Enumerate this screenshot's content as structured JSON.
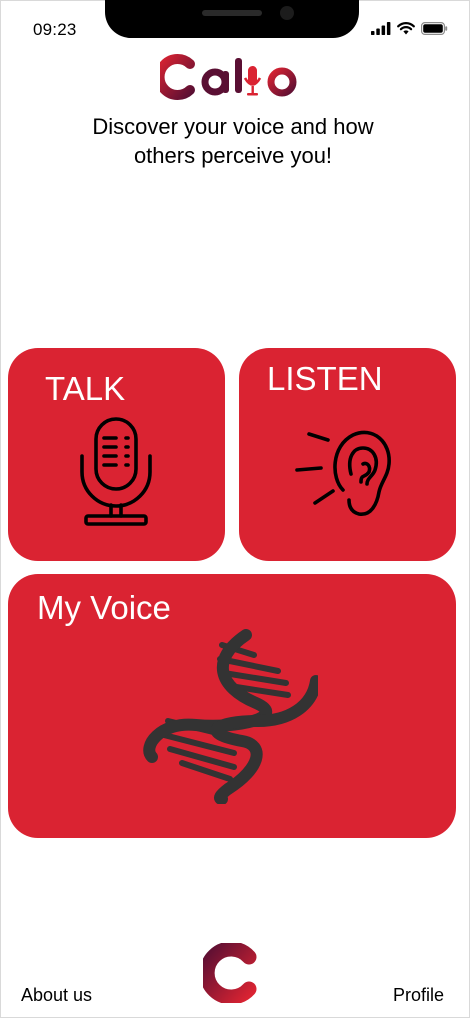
{
  "status_bar": {
    "time": "09:23"
  },
  "brand": {
    "name": "Callo",
    "color_primary": "#da2332",
    "color_dark": "#5a0f33"
  },
  "header": {
    "tagline": "Discover your voice and how\nothers perceive you!"
  },
  "tiles": {
    "talk": {
      "label": "TALK",
      "icon": "microphone-icon"
    },
    "listen": {
      "label": "LISTEN",
      "icon": "ear-icon"
    },
    "my_voice": {
      "label": "My Voice",
      "icon": "dna-icon"
    }
  },
  "footer": {
    "about_label": "About us",
    "profile_label": "Profile"
  }
}
